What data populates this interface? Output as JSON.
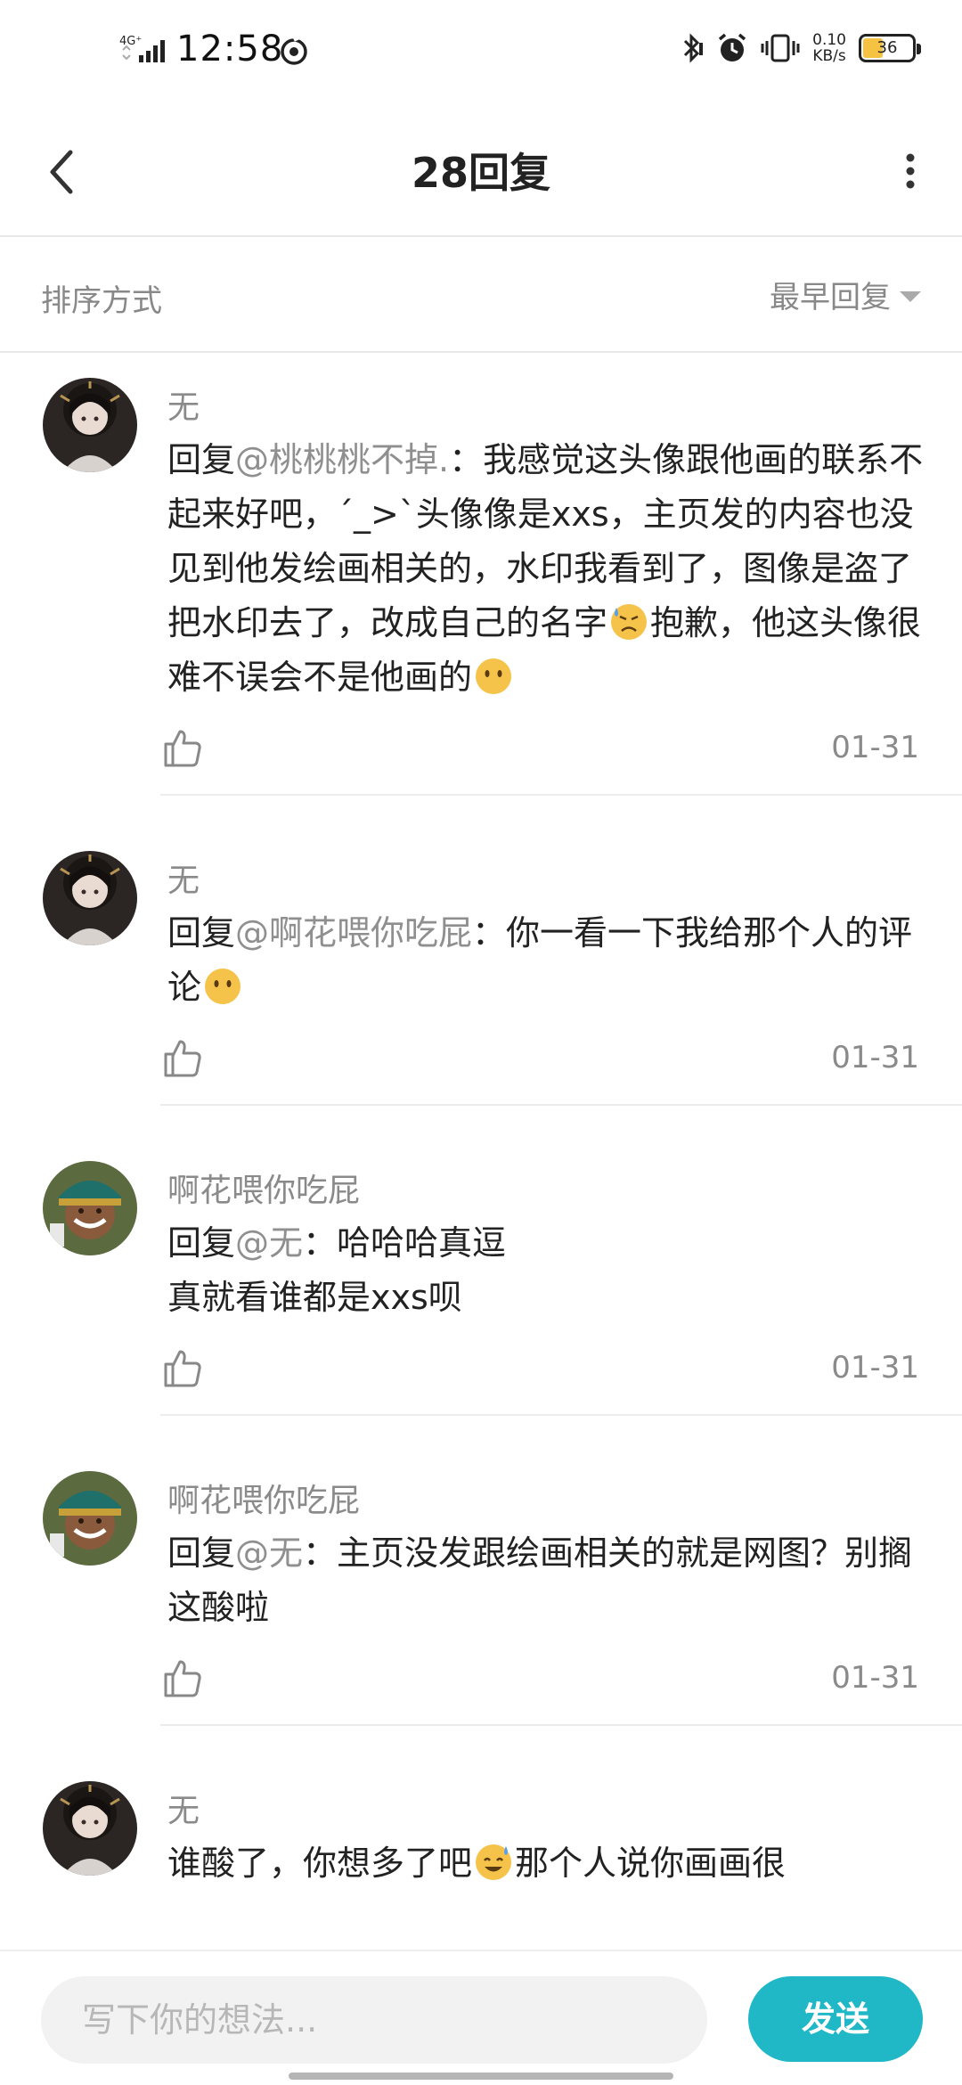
{
  "status_bar": {
    "network": "4G⁺",
    "time": "12:58",
    "speed_value": "0.10",
    "speed_unit": "KB/s",
    "battery": "36"
  },
  "header": {
    "title": "28回复"
  },
  "sort": {
    "label": "排序方式",
    "option": "最早回复"
  },
  "comments": [
    {
      "user": "无",
      "prefix": "回复",
      "mention": "@桃桃桃不掉.",
      "sep": "：",
      "text1": "我感觉这头像跟他画的联系不起来好吧，´_>`头像像是xxs，主页发的内容也没见到他发绘画相关的，水印我看到了，图像是盗了把水印去了，改成自己的名字",
      "text2": "抱歉，他这头像很难不误会不是他画的",
      "date": "01-31"
    },
    {
      "user": "无",
      "prefix": "回复",
      "mention": "@啊花喂你吃屁",
      "sep": "：",
      "text1": "你一看一下我给那个人的评论",
      "date": "01-31"
    },
    {
      "user": "啊花喂你吃屁",
      "prefix": "回复",
      "mention": "@无",
      "sep": "：",
      "text1": "哈哈哈真逗",
      "text2": "真就看谁都是xxs呗",
      "date": "01-31"
    },
    {
      "user": "啊花喂你吃屁",
      "prefix": "回复",
      "mention": "@无",
      "sep": "：",
      "text1": "主页没发跟绘画相关的就是网图？别搁这酸啦",
      "date": "01-31"
    },
    {
      "user": "无",
      "text1": "谁酸了，你想多了吧",
      "text2": "那个人说你画画很"
    }
  ],
  "input": {
    "placeholder": "写下你的想法..."
  },
  "send_label": "发送",
  "colors": {
    "accent": "#20b7c6",
    "mention": "#8f8f8f"
  }
}
